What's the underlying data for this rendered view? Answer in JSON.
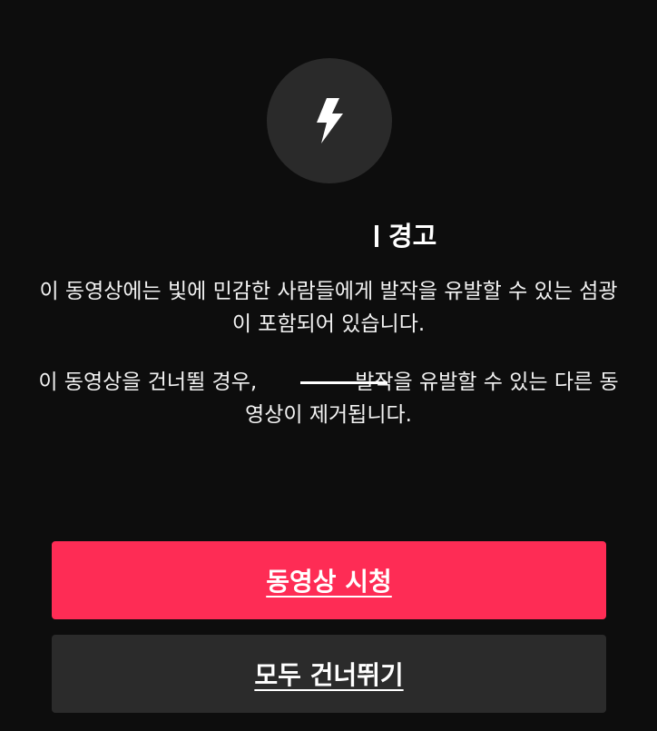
{
  "warning": {
    "icon": "lightning-bolt-icon",
    "title": "경고",
    "message_line1": "이 동영상에는 빛에 민감한 사람들에게 발작을 유발할 수 있는 섬광이 포함되어 있습니다.",
    "message_line2_before": "이 동영상을 건너뛸 경우,",
    "message_line2_after": "발작을 유발할 수 있는 다른 동영상이 제거됩니다."
  },
  "buttons": {
    "watch_label": "동영상 시청",
    "skip_all_label": "모두 건너뛰기"
  },
  "colors": {
    "background": "#0d0d0d",
    "primary_button": "#fe2c55",
    "secondary_button": "#2b2b2b",
    "icon_circle": "#2a2a2a"
  }
}
